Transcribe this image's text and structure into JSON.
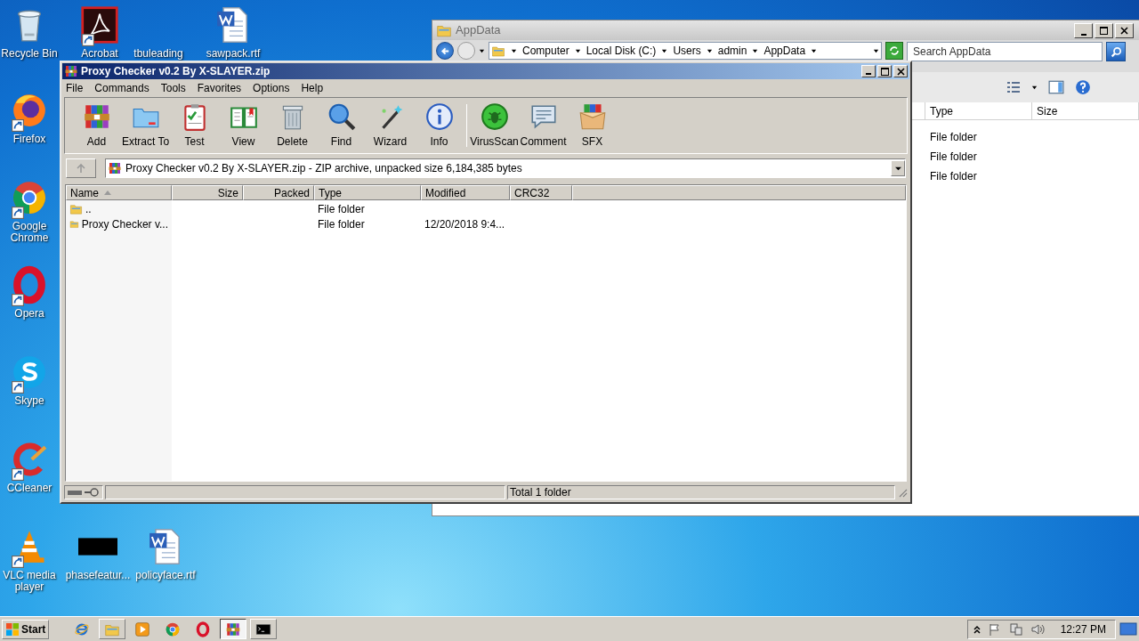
{
  "desktop_icons": [
    {
      "label": "Recycle Bin",
      "kind": "recycle",
      "shortcut": false
    },
    {
      "label": "Acrobat",
      "kind": "acrobat",
      "shortcut": true
    },
    {
      "label": "tbuleading",
      "kind": "blank",
      "shortcut": false
    },
    {
      "label": "sawpack.rtf",
      "kind": "word",
      "shortcut": false
    },
    {
      "label": "Firefox",
      "kind": "firefox",
      "shortcut": true
    },
    {
      "label": "Google Chrome",
      "kind": "chrome",
      "shortcut": true
    },
    {
      "label": "Opera",
      "kind": "opera",
      "shortcut": true
    },
    {
      "label": "Skype",
      "kind": "skype",
      "shortcut": true
    },
    {
      "label": "CCleaner",
      "kind": "ccleaner",
      "shortcut": true
    },
    {
      "label": "VLC media player",
      "kind": "vlc",
      "shortcut": true
    },
    {
      "label": "phasefeatur...",
      "kind": "black",
      "shortcut": false
    },
    {
      "label": "policyface.rtf",
      "kind": "word",
      "shortcut": false
    }
  ],
  "explorer_window": {
    "title": "AppData",
    "breadcrumbs": [
      "Computer",
      "Local Disk (C:)",
      "Users",
      "admin",
      "AppData"
    ],
    "search": {
      "placeholder": "Search AppData"
    },
    "columns": [
      "Type",
      "Size"
    ],
    "rows": [
      {
        "type": "File folder"
      },
      {
        "type": "File folder"
      },
      {
        "type": "File folder"
      }
    ]
  },
  "archive_window": {
    "title": "Proxy Checker v0.2 By X-SLAYER.zip",
    "menu": [
      "File",
      "Commands",
      "Tools",
      "Favorites",
      "Options",
      "Help"
    ],
    "toolbar_groups": [
      {
        "buttons": [
          {
            "label": "Add",
            "kind": "add"
          },
          {
            "label": "Extract To",
            "kind": "extract"
          },
          {
            "label": "Test",
            "kind": "test"
          },
          {
            "label": "View",
            "kind": "view"
          },
          {
            "label": "Delete",
            "kind": "delete"
          },
          {
            "label": "Find",
            "kind": "find"
          },
          {
            "label": "Wizard",
            "kind": "wizard"
          },
          {
            "label": "Info",
            "kind": "info"
          }
        ]
      },
      {
        "buttons": [
          {
            "label": "VirusScan",
            "kind": "virusscan"
          },
          {
            "label": "Comment",
            "kind": "comment"
          },
          {
            "label": "SFX",
            "kind": "sfx"
          }
        ]
      }
    ],
    "path": "Proxy Checker v0.2 By X-SLAYER.zip - ZIP archive, unpacked size 6,184,385 bytes",
    "columns": [
      {
        "label": "Name",
        "sorted": true
      },
      {
        "label": "Size",
        "sorted": false
      },
      {
        "label": "Packed",
        "sorted": false
      },
      {
        "label": "Type",
        "sorted": false
      },
      {
        "label": "Modified",
        "sorted": false
      },
      {
        "label": "CRC32",
        "sorted": false
      }
    ],
    "rows": [
      {
        "name": "..",
        "type": "File folder"
      },
      {
        "name": "Proxy Checker v...",
        "type": "File folder",
        "modified": "12/20/2018 9:4..."
      }
    ],
    "status": "Total 1 folder"
  },
  "taskbar": {
    "start": "Start",
    "apps": [
      {
        "kind": "ie",
        "running": false,
        "selected": false
      },
      {
        "kind": "explorer",
        "running": true,
        "selected": false
      },
      {
        "kind": "media",
        "running": false,
        "selected": false
      },
      {
        "kind": "chrome",
        "running": false,
        "selected": false
      },
      {
        "kind": "opera",
        "running": false,
        "selected": false
      },
      {
        "kind": "add",
        "running": true,
        "selected": true
      },
      {
        "kind": "cmd",
        "running": true,
        "selected": false
      }
    ],
    "clock": "12:27 PM"
  }
}
